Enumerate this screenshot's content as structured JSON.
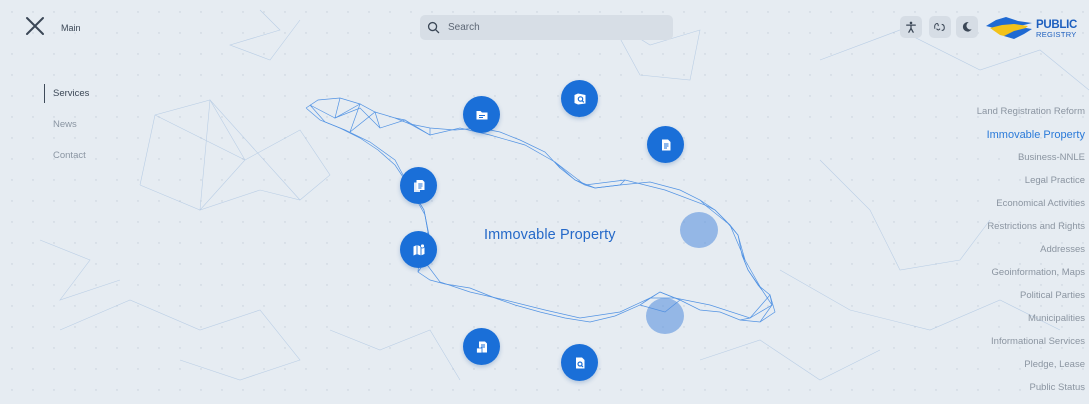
{
  "header": {
    "main_label": "Main",
    "search_placeholder": "Search"
  },
  "logo": {
    "top_text": "",
    "main_text": "PUBLIC",
    "sub_text": "REGISTRY"
  },
  "left_nav": {
    "items": [
      {
        "label": "Services",
        "active": true
      },
      {
        "label": "News",
        "active": false
      },
      {
        "label": "Contact",
        "active": false
      }
    ]
  },
  "right_nav": {
    "items": [
      {
        "label": "Land Registration Reform"
      },
      {
        "label": "Immovable Property",
        "active": true
      },
      {
        "label": "Business-NNLE"
      },
      {
        "label": "Legal Practice"
      },
      {
        "label": "Economical Activities"
      },
      {
        "label": "Restrictions and Rights"
      },
      {
        "label": "Addresses"
      },
      {
        "label": "Geoinformation, Maps"
      },
      {
        "label": "Political Parties"
      },
      {
        "label": "Municipalities"
      },
      {
        "label": "Informational Services"
      },
      {
        "label": "Pledge, Lease"
      },
      {
        "label": "Public Status"
      }
    ]
  },
  "center": {
    "title": "Immovable Property"
  },
  "colors": {
    "accent": "#1a6fd8",
    "background": "#e6ecf2",
    "active_nav": "#2a7ad9"
  },
  "tools": [
    "accessibility-icon",
    "sign-language-icon",
    "dark-mode-icon"
  ],
  "orbit_icons": [
    "folder-icon",
    "search-document-icon",
    "document-icon",
    "documents-icon",
    "map-icon",
    "document-edit-icon",
    "search-file-icon"
  ]
}
